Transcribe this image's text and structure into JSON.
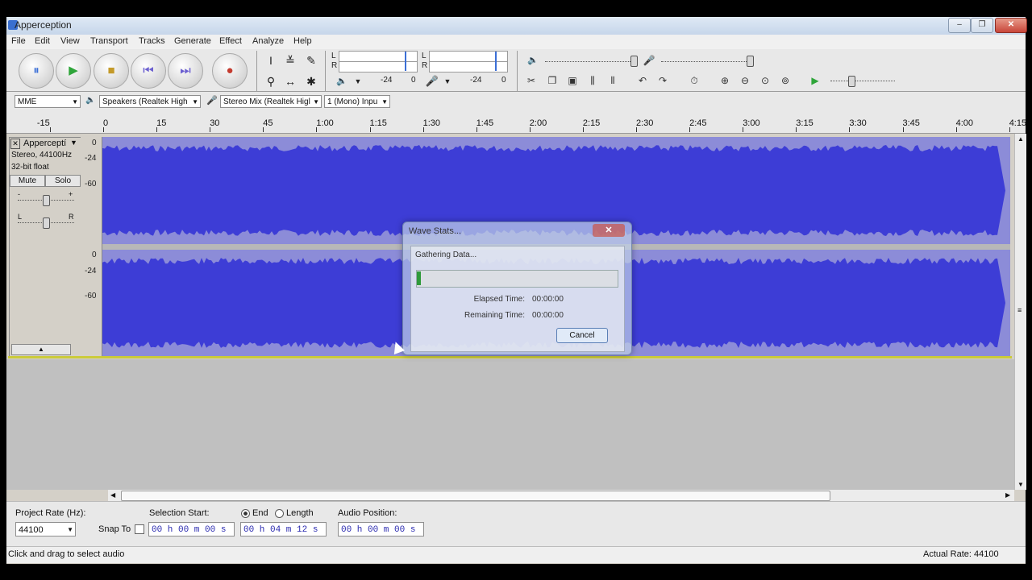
{
  "window": {
    "title": "Apperception",
    "minimize": "‒",
    "maximize": "❐",
    "close": "✕"
  },
  "menu": [
    "File",
    "Edit",
    "View",
    "Transport",
    "Tracks",
    "Generate",
    "Effect",
    "Analyze",
    "Help"
  ],
  "transport": {
    "pause": "⏸",
    "play": "▶",
    "stop": "■",
    "skip_start": "⏮",
    "skip_end": "⏭",
    "record": "●"
  },
  "meters": {
    "left": "L",
    "right": "R",
    "play_db_1": "-24",
    "play_db_2": "0",
    "rec_db_1": "-24",
    "rec_db_2": "0"
  },
  "device": {
    "host": "MME",
    "output": "Speakers (Realtek High",
    "input": "Stereo Mix (Realtek Higl",
    "channels": "1 (Mono) Inpu"
  },
  "ruler": [
    "-15",
    "0",
    "15",
    "30",
    "45",
    "1:00",
    "1:15",
    "1:30",
    "1:45",
    "2:00",
    "2:15",
    "2:30",
    "2:45",
    "3:00",
    "3:15",
    "3:30",
    "3:45",
    "4:00",
    "4:15"
  ],
  "track": {
    "name": "Apperception",
    "name_shown": "Apperceptí",
    "info_1": "Stereo, 44100Hz",
    "info_2": "32-bit float",
    "mute": "Mute",
    "solo": "Solo",
    "gain_minus": "-",
    "gain_plus": "+",
    "pan_l": "L",
    "pan_r": "R",
    "db_labels": [
      "0",
      "-24",
      "-60"
    ]
  },
  "dialog": {
    "title": "Wave Stats...",
    "status": "Gathering Data...",
    "progress": 0.02,
    "elapsed_label": "Elapsed Time:",
    "elapsed_value": "00:00:00",
    "remaining_label": "Remaining Time:",
    "remaining_value": "00:00:00",
    "cancel": "Cancel"
  },
  "selection": {
    "rate_label": "Project Rate (Hz):",
    "rate_value": "44100",
    "snap_label": "Snap To",
    "start_label": "Selection Start:",
    "end_label": "End",
    "length_label": "Length",
    "audio_pos_label": "Audio Position:",
    "start_value": "00 h 00 m 00 s",
    "end_value": "00 h 04 m 12 s",
    "audio_pos_value": "00 h 00 m 00 s"
  },
  "status": {
    "left": "Click and drag to select audio",
    "right": "Actual Rate: 44100"
  },
  "colors": {
    "waveform": "#4a4ad8",
    "accent_green": "#2f9a3a",
    "record": "#c43b2f"
  }
}
